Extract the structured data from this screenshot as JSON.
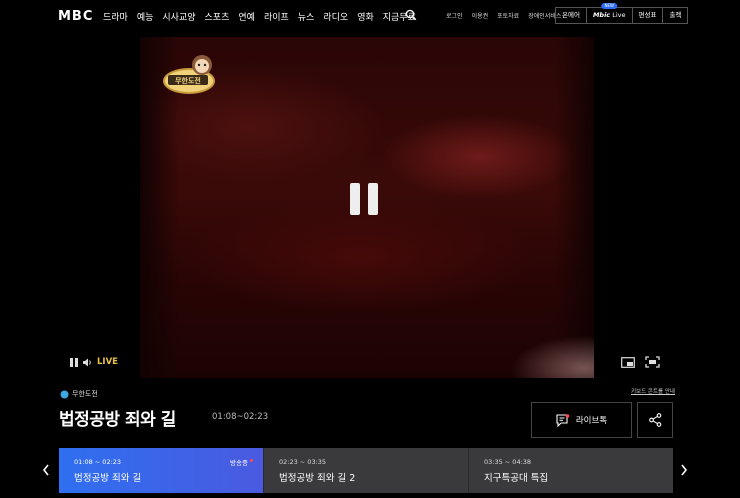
{
  "header": {
    "logo": "MBC",
    "nav": [
      "드라마",
      "예능",
      "시사교양",
      "스포츠",
      "연예",
      "라이프",
      "뉴스",
      "라디오",
      "영화",
      "지금무료"
    ],
    "util": [
      "로그인",
      "이용권",
      "포토자료",
      "장애인서비스"
    ],
    "buttons": {
      "onair": "온에어",
      "live_prefix": "Mbic",
      "live_suffix": " Live",
      "new": "NEW",
      "schedule": "편성표",
      "replay": "출첵"
    }
  },
  "player": {
    "live_label": "LIVE",
    "program_logo_text": "무한도전"
  },
  "info": {
    "program": "무한도전",
    "title": "법정공방 죄와 길",
    "time": "01:08~02:23",
    "guide_link": "키보드 콘트롤 안내",
    "livetalk": "라이브톡"
  },
  "schedule": [
    {
      "time": "01:08 ~ 02:23",
      "name": "법정공방 죄와 길",
      "onair": "방송중"
    },
    {
      "time": "02:23 ~ 03:35",
      "name": "법정공방 죄와 길 2"
    },
    {
      "time": "03:35 ~ 04:38",
      "name": "지구특공대 특집"
    }
  ],
  "colors": {
    "accent": "#2f6ff0",
    "live": "#e8c24a",
    "onair_dot": "#ff4b4b"
  }
}
